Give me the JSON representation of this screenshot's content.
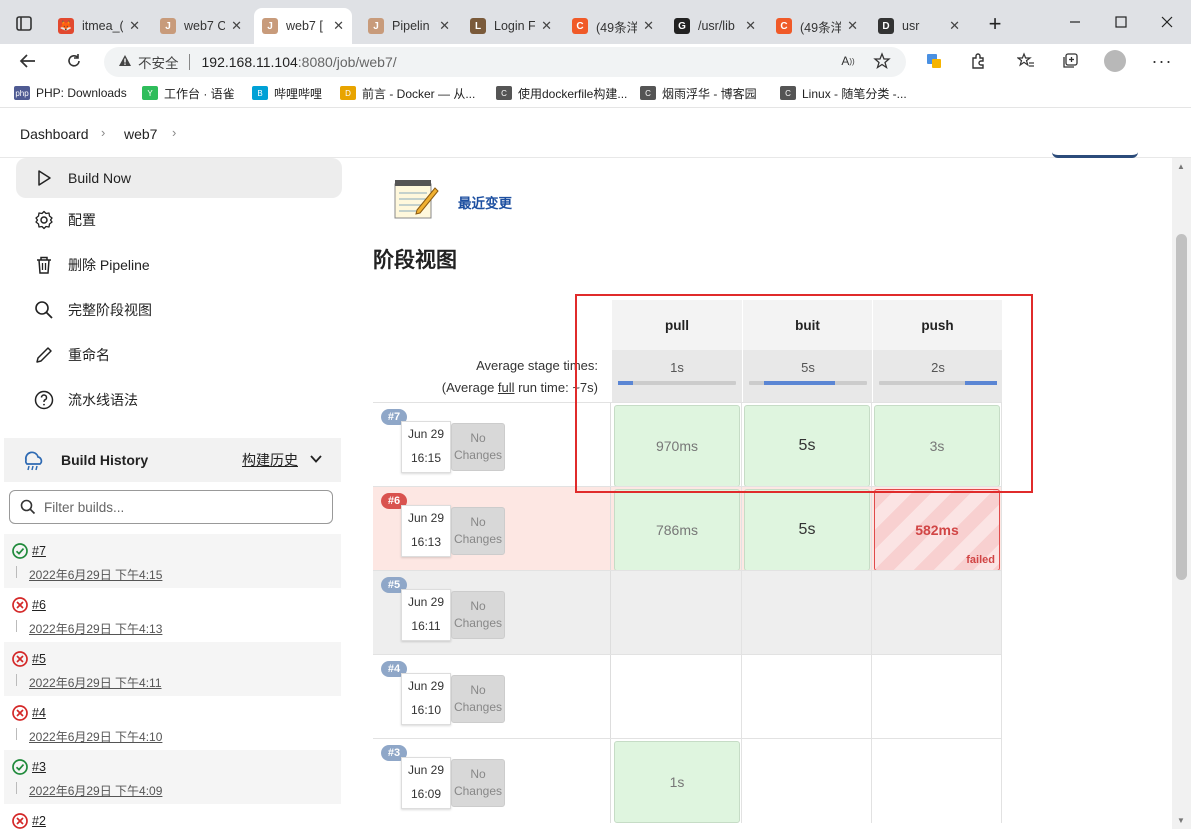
{
  "browser": {
    "tabs": [
      {
        "title": "itmea_(",
        "color": "#e2492f",
        "glyph": "🦊",
        "active": false
      },
      {
        "title": "web7 C",
        "color": "#c89b7b",
        "glyph": "J",
        "active": false
      },
      {
        "title": "web7 [",
        "color": "#c89b7b",
        "glyph": "J",
        "active": true
      },
      {
        "title": "Pipelin",
        "color": "#c89b7b",
        "glyph": "J",
        "active": false
      },
      {
        "title": "Login F",
        "color": "#7a5a3a",
        "glyph": "L",
        "active": false
      },
      {
        "title": "(49条洋",
        "color": "#f05a28",
        "glyph": "C",
        "active": false
      },
      {
        "title": "/usr/lib",
        "color": "#222222",
        "glyph": "G",
        "active": false
      },
      {
        "title": "(49条洋",
        "color": "#f05a28",
        "glyph": "C",
        "active": false
      },
      {
        "title": "usr",
        "color": "#333333",
        "glyph": "D",
        "active": false
      }
    ],
    "url": {
      "insecure_label": "不安全",
      "host": "192.168.11.104",
      "rest": ":8080/job/web7/"
    },
    "bookmarks": [
      {
        "label": "PHP: Downloads",
        "color": "#4f5b93",
        "glyph": "php"
      },
      {
        "label": "工作台 · 语雀",
        "color": "#2fbd5b",
        "glyph": "Y"
      },
      {
        "label": "哔哩哔哩",
        "color": "#00a1d6",
        "glyph": "B"
      },
      {
        "label": "前言 - Docker — 从...",
        "color": "#e8a400",
        "glyph": "D"
      },
      {
        "label": "使用dockerfile构建...",
        "color": "#555555",
        "glyph": "C"
      },
      {
        "label": "烟雨浮华 - 博客园",
        "color": "#555555",
        "glyph": "C"
      },
      {
        "label": "Linux - 随笔分类 -...",
        "color": "#555555",
        "glyph": "C"
      }
    ]
  },
  "breadcrumb": {
    "items": [
      "Dashboard",
      "web7"
    ]
  },
  "sidebar": {
    "items": [
      {
        "label": "Build Now",
        "icon": "play-icon",
        "highlight": true
      },
      {
        "label": "配置",
        "icon": "gear-icon"
      },
      {
        "label": "删除 Pipeline",
        "icon": "trash-icon"
      },
      {
        "label": "完整阶段视图",
        "icon": "search-icon"
      },
      {
        "label": "重命名",
        "icon": "pencil-icon"
      },
      {
        "label": "流水线语法",
        "icon": "help-icon"
      }
    ],
    "build_history": {
      "title": "Build History",
      "trend_label": "构建历史",
      "filter_placeholder": "Filter builds...",
      "builds": [
        {
          "num": "#7",
          "date": "2022年6月29日 下午4:15",
          "status": "success"
        },
        {
          "num": "#6",
          "date": "2022年6月29日 下午4:13",
          "status": "failed"
        },
        {
          "num": "#5",
          "date": "2022年6月29日 下午4:11",
          "status": "failed"
        },
        {
          "num": "#4",
          "date": "2022年6月29日 下午4:10",
          "status": "failed"
        },
        {
          "num": "#3",
          "date": "2022年6月29日 下午4:09",
          "status": "success"
        },
        {
          "num": "#2",
          "date": "",
          "status": "failed"
        }
      ]
    }
  },
  "main": {
    "recent_changes": "最近变更",
    "stage_view_title": "阶段视图",
    "avg_stage_times": "Average stage times:",
    "avg_full_prefix": "(Average ",
    "avg_full_link": "full",
    "avg_full_suffix": " run time: ~7s)",
    "stages": [
      {
        "name": "pull",
        "avg": "1s",
        "fill_start": 0.0,
        "fill_end": 0.13
      },
      {
        "name": "buit",
        "avg": "5s",
        "fill_start": 0.13,
        "fill_end": 0.73
      },
      {
        "name": "push",
        "avg": "2s",
        "fill_start": 0.73,
        "fill_end": 1.0
      }
    ],
    "runs": [
      {
        "num": "#7",
        "date": "Jun 29",
        "time": "16:15",
        "changes": [
          "No",
          "Changes"
        ],
        "badge_color": "#8fa7c8",
        "row_bg": "#ffffff",
        "cells": [
          {
            "text": "970ms",
            "state": "ok"
          },
          {
            "text": "5s",
            "state": "ok",
            "big": true
          },
          {
            "text": "3s",
            "state": "ok"
          }
        ]
      },
      {
        "num": "#6",
        "date": "Jun 29",
        "time": "16:13",
        "changes": [
          "No",
          "Changes"
        ],
        "badge_color": "#d9534f",
        "row_bg": "#fde7e3",
        "cells": [
          {
            "text": "786ms",
            "state": "ok"
          },
          {
            "text": "5s",
            "state": "ok",
            "big": true
          },
          {
            "text": "582ms",
            "state": "fail",
            "tag": "failed"
          }
        ]
      },
      {
        "num": "#5",
        "date": "Jun 29",
        "time": "16:11",
        "changes": [
          "No",
          "Changes"
        ],
        "badge_color": "#8fa7c8",
        "row_bg": "#eeeeee",
        "cells": [
          {
            "text": "",
            "state": "empty"
          },
          {
            "text": "",
            "state": "empty"
          },
          {
            "text": "",
            "state": "empty"
          }
        ]
      },
      {
        "num": "#4",
        "date": "Jun 29",
        "time": "16:10",
        "changes": [
          "No",
          "Changes"
        ],
        "badge_color": "#8fa7c8",
        "row_bg": "#ffffff",
        "cells": [
          {
            "text": "",
            "state": "empty"
          },
          {
            "text": "",
            "state": "empty"
          },
          {
            "text": "",
            "state": "empty"
          }
        ]
      },
      {
        "num": "#3",
        "date": "Jun 29",
        "time": "16:09",
        "changes": [
          "No",
          "Changes"
        ],
        "badge_color": "#8fa7c8",
        "row_bg": "#ffffff",
        "cells": [
          {
            "text": "1s",
            "state": "ok"
          },
          {
            "text": "",
            "state": "empty"
          },
          {
            "text": "",
            "state": "empty"
          }
        ]
      }
    ]
  }
}
